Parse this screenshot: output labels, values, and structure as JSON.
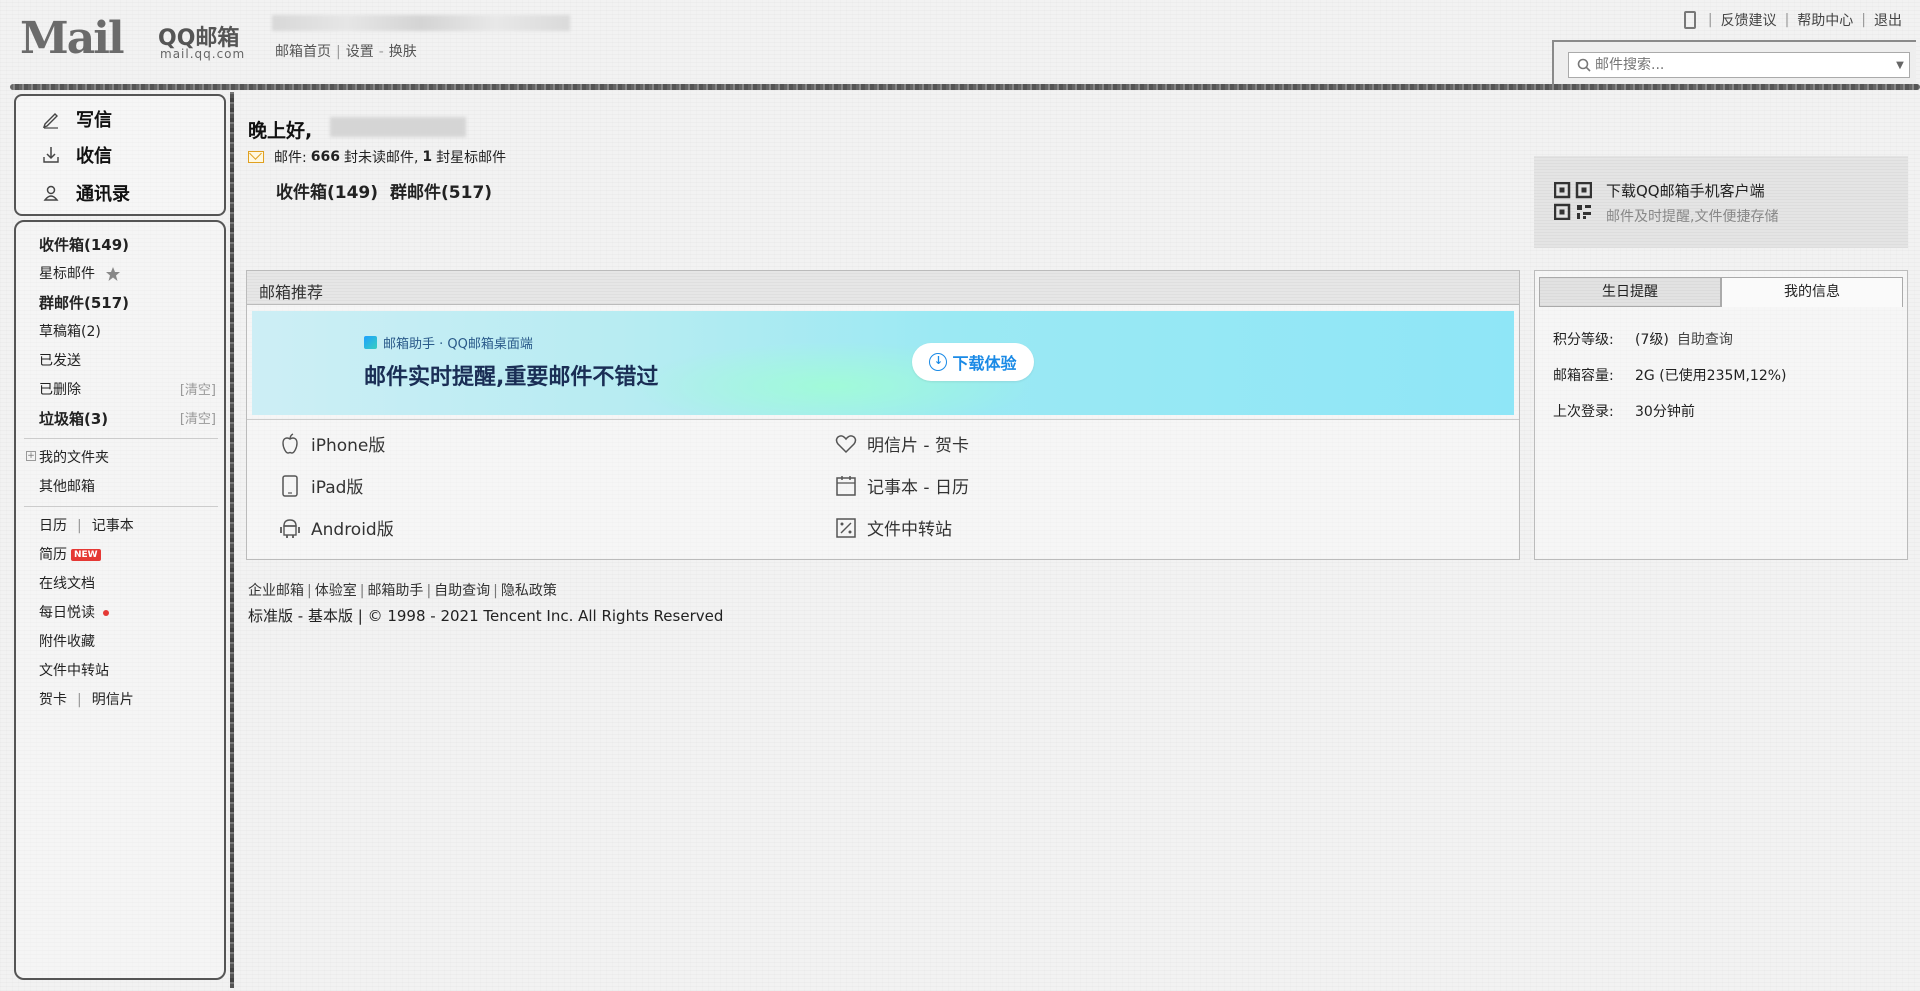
{
  "header": {
    "logo_mail": "Mail",
    "logo_qq": "QQ邮箱",
    "logo_domain": "mail.qq.com",
    "nav_links": [
      "邮箱首页",
      "设置",
      "换肤"
    ],
    "right_links": [
      "反馈建议",
      "帮助中心",
      "退出"
    ]
  },
  "search": {
    "placeholder": "邮件搜索..."
  },
  "left_actions": [
    {
      "label": "写信",
      "icon": "pencil-icon"
    },
    {
      "label": "收信",
      "icon": "download-icon"
    },
    {
      "label": "通讯录",
      "icon": "contacts-icon"
    }
  ],
  "folders": {
    "inbox": "收件箱(149)",
    "starred": "星标邮件",
    "group": "群邮件(517)",
    "drafts": "草稿箱(2)",
    "sent": "已发送",
    "deleted": "已删除",
    "spam": "垃圾箱(3)",
    "clear": "[清空]",
    "my_folders": "我的文件夹",
    "other_mail": "其他邮箱",
    "calendar": "日历",
    "notebook": "记事本",
    "resume": "简历",
    "resume_badge": "NEW",
    "docs": "在线文档",
    "daily_read": "每日悦读",
    "attachments": "附件收藏",
    "file_transfer": "文件中转站",
    "greeting_card": "贺卡",
    "postcard": "明信片"
  },
  "greeting": {
    "text": "晚上好,",
    "mail_prefix": "邮件:",
    "unread_count": "666",
    "unread_text": "封未读邮件,",
    "star_count": "1",
    "star_text": "封星标邮件",
    "quick_inbox": "收件箱(149)",
    "quick_group": "群邮件(517)"
  },
  "app_download": {
    "title": "下载QQ邮箱手机客户端",
    "subtitle": "邮件及时提醒,文件便捷存储"
  },
  "recommend": {
    "title": "邮箱推荐",
    "banner_sub": "邮箱助手 · QQ邮箱桌面端",
    "banner_main": "邮件实时提醒,重要邮件不错过",
    "banner_button": "下载体验",
    "items": [
      {
        "label": "iPhone版",
        "icon": "apple-icon"
      },
      {
        "label": "iPad版",
        "icon": "tablet-icon"
      },
      {
        "label": "Android版",
        "icon": "android-icon"
      },
      {
        "label": "明信片 - 贺卡",
        "icon": "heart-icon"
      },
      {
        "label": "记事本 - 日历",
        "icon": "calendar-icon"
      },
      {
        "label": "文件中转站",
        "icon": "transfer-icon"
      }
    ]
  },
  "info": {
    "tabs": [
      "生日提醒",
      "我的信息"
    ],
    "level_label": "积分等级:",
    "level_value": "(7级)",
    "level_link": "自助查询",
    "capacity_label": "邮箱容量:",
    "capacity_value": "2G (已使用235M,12%)",
    "last_login_label": "上次登录:",
    "last_login_value": "30分钟前"
  },
  "footer": {
    "links": [
      "企业邮箱",
      "体验室",
      "邮箱助手",
      "自助查询",
      "隐私政策"
    ],
    "version_standard": "标准版",
    "version_basic": "基本版",
    "copyright": "© 1998 - 2021 Tencent Inc. All Rights Reserved"
  }
}
